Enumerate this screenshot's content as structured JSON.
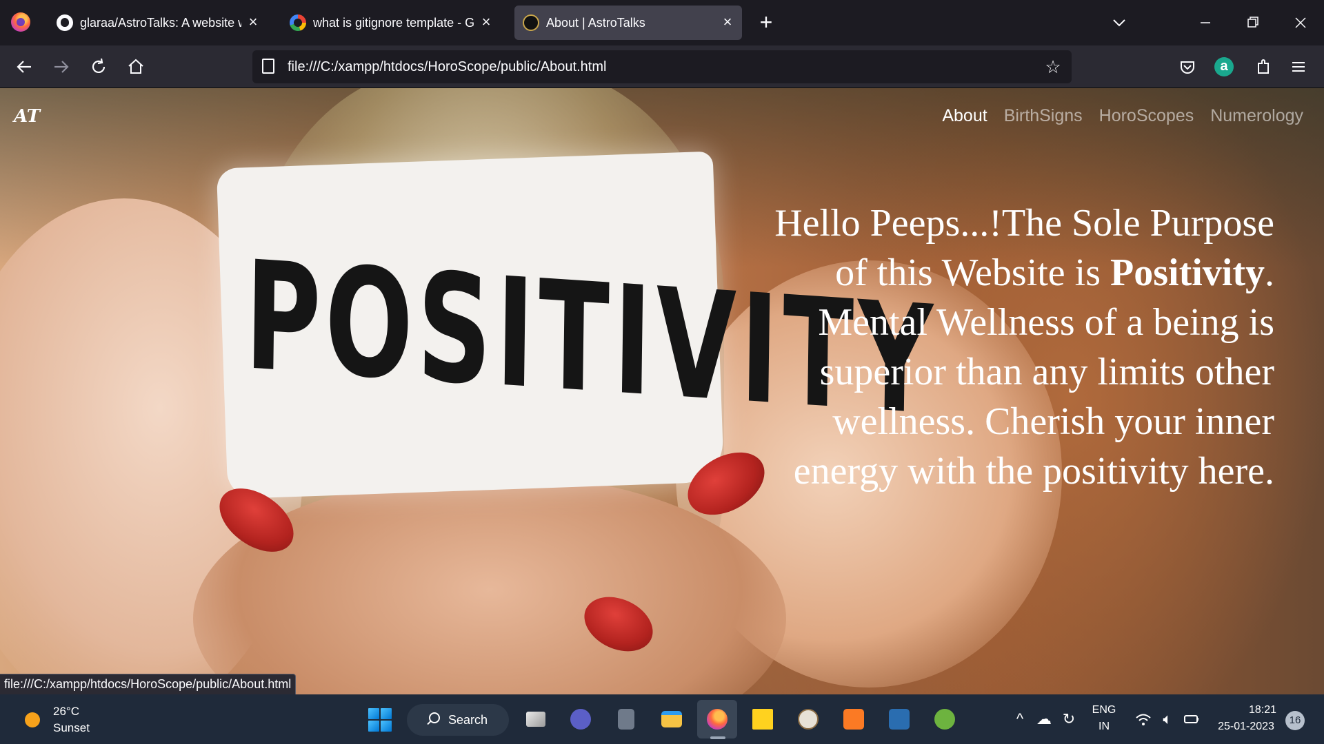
{
  "browser": {
    "tabs": [
      {
        "title": "glaraa/AstroTalks: A website wh",
        "favicon": "github-icon"
      },
      {
        "title": "what is gitignore template - Goo",
        "favicon": "google-icon"
      },
      {
        "title": "About | AstroTalks",
        "favicon": "astrotalks-icon",
        "active": true
      }
    ],
    "new_tab_glyph": "+",
    "close_glyph": "×",
    "url": "file:///C:/xampp/htdocs/HoroScope/public/About.html",
    "status_link": "file:///C:/xampp/htdocs/HoroScope/public/About.html",
    "profile_letter": "a"
  },
  "site": {
    "logo": "AT",
    "nav": [
      {
        "label": "About",
        "current": true
      },
      {
        "label": "BirthSigns"
      },
      {
        "label": "HoroScopes"
      },
      {
        "label": "Numerology"
      }
    ],
    "hero": {
      "before": "Hello Peeps...!The Sole Purpose of this Website is ",
      "bold": "Positivity",
      "after": ". Mental Wellness of a being is superior than any limits other wellness. Cherish your inner energy with the positivity here."
    },
    "image_label_text": "POSITIVITY"
  },
  "taskbar": {
    "weather": {
      "temp": "26°C",
      "desc": "Sunset"
    },
    "search_label": "Search",
    "language": {
      "line1": "ENG",
      "line2": "IN"
    },
    "time": "18:21",
    "date": "25-01-2023",
    "notifications": "16"
  },
  "colors": {
    "chrome_dark": "#1c1b22",
    "chrome_nav": "#2b2a33",
    "taskbar": "#1f2a3a",
    "nail_red": "#c0282a"
  }
}
